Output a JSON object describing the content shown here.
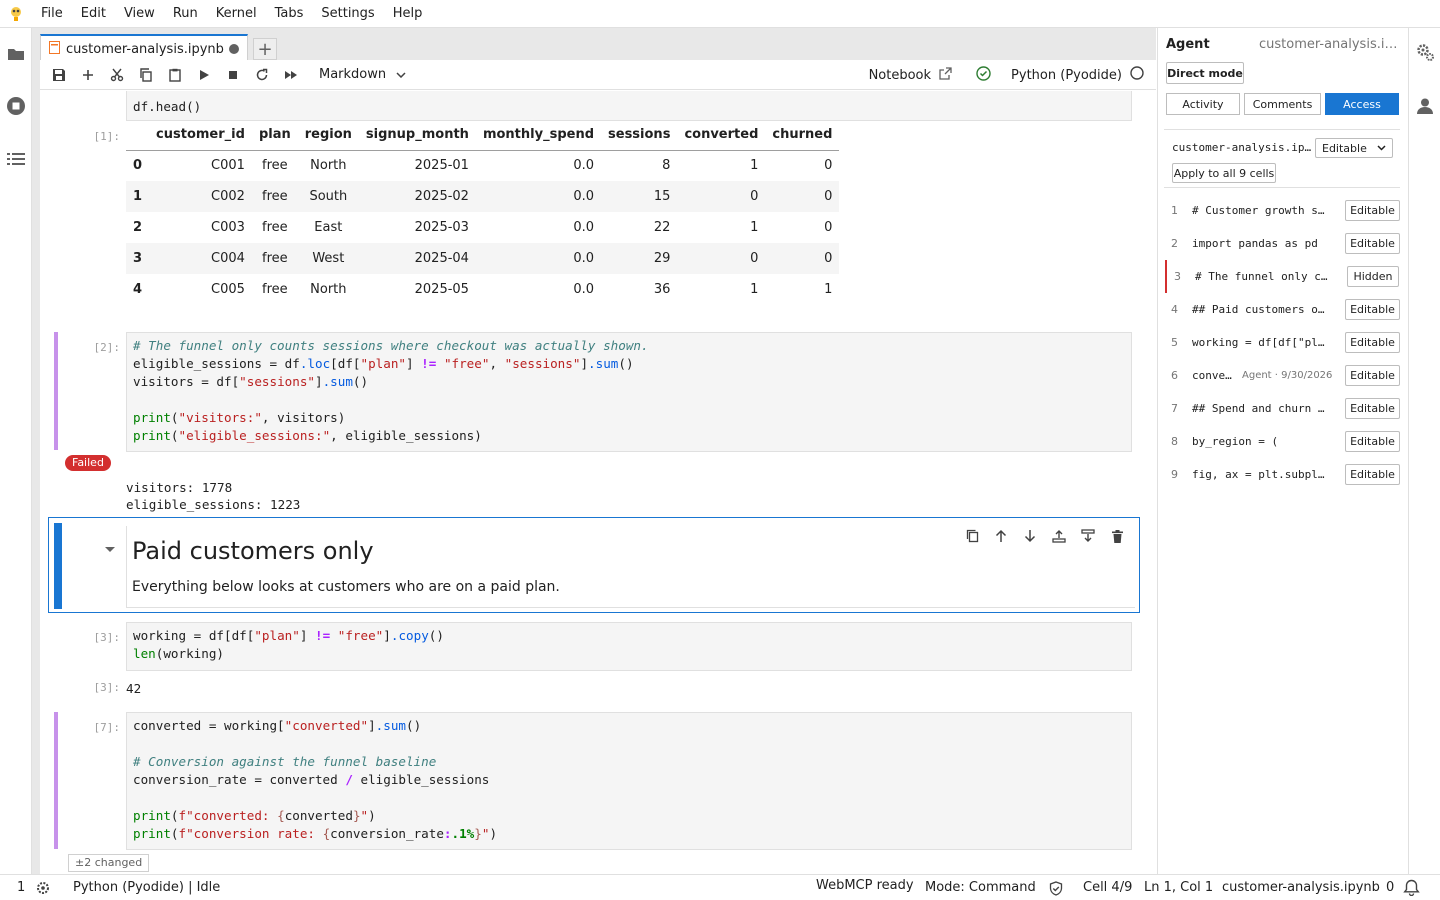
{
  "menubar": {
    "items": [
      "File",
      "Edit",
      "View",
      "Run",
      "Kernel",
      "Tabs",
      "Settings",
      "Help"
    ]
  },
  "tab": {
    "title": "customer-analysis.ipynb"
  },
  "toolbar": {
    "cell_type": "Markdown",
    "notebook_label": "Notebook",
    "kernel_name": "Python (Pyodide)"
  },
  "cells": {
    "c0": {
      "tail_code": "df.head()"
    },
    "out1": {
      "prompt": "[1]:",
      "columns": [
        "customer_id",
        "plan",
        "region",
        "signup_month",
        "monthly_spend",
        "sessions",
        "converted",
        "churned"
      ],
      "rows": [
        [
          "0",
          "C001",
          "free",
          "North",
          "2025-01",
          "0.0",
          "8",
          "1",
          "0"
        ],
        [
          "1",
          "C002",
          "free",
          "South",
          "2025-02",
          "0.0",
          "15",
          "0",
          "0"
        ],
        [
          "2",
          "C003",
          "free",
          "East",
          "2025-03",
          "0.0",
          "22",
          "1",
          "0"
        ],
        [
          "3",
          "C004",
          "free",
          "West",
          "2025-04",
          "0.0",
          "29",
          "0",
          "0"
        ],
        [
          "4",
          "C005",
          "free",
          "North",
          "2025-05",
          "0.0",
          "36",
          "1",
          "1"
        ]
      ]
    },
    "c2": {
      "prompt": "[2]:",
      "status_badge": "Failed",
      "output_lines": [
        "visitors: 1778",
        "eligible_sessions: 1223"
      ]
    },
    "c3": {
      "heading": "Paid customers only",
      "paragraph": "Everything below looks at customers who are on a paid plan."
    },
    "c4": {
      "prompt": "[3]:",
      "out_prompt": "[3]:",
      "output": "42"
    },
    "c5": {
      "prompt": "[7]:",
      "diff_badge": "±2 changed"
    }
  },
  "agent": {
    "title": "Agent",
    "file": "customer-analysis.ipynb",
    "direct_mode": "Direct mode",
    "tabs": [
      "Activity",
      "Comments",
      "Access"
    ],
    "active_tab": "Access",
    "access_file": "customer-analysis.ipynb",
    "access_select": "Editable",
    "apply_all": "Apply to all 9 cells",
    "cells": [
      {
        "idx": "1",
        "src": "# Customer growth sc...",
        "mode": "Editable"
      },
      {
        "idx": "2",
        "src": "import pandas as pd",
        "mode": "Editable"
      },
      {
        "idx": "3",
        "src": "# The funnel only co...",
        "mode": "Hidden"
      },
      {
        "idx": "4",
        "src": "## Paid customers on...",
        "mode": "Editable"
      },
      {
        "idx": "5",
        "src": "working = df[df[\"pla...",
        "mode": "Editable"
      },
      {
        "idx": "6",
        "src": "conve...",
        "meta": "Agent · 9/30/2026",
        "mode": "Editable"
      },
      {
        "idx": "7",
        "src": "## Spend and churn b...",
        "mode": "Editable"
      },
      {
        "idx": "8",
        "src": "by_region = (",
        "mode": "Editable"
      },
      {
        "idx": "9",
        "src": "fig, ax = plt.subplo...",
        "mode": "Editable"
      }
    ]
  },
  "status": {
    "left_count": "1",
    "kernel": "Python (Pyodide) | Idle",
    "webmcp": "WebMCP ready",
    "mode": "Mode: Command",
    "cell": "Cell 4/9",
    "cursor": "Ln 1, Col 1",
    "file": "customer-analysis.ipynb",
    "notifications": "0"
  },
  "colors": {
    "accent": "#1976d2",
    "failed": "#d32f2f",
    "kernel_ok": "#2e7d32",
    "edited_collapser": "#c792ea"
  }
}
